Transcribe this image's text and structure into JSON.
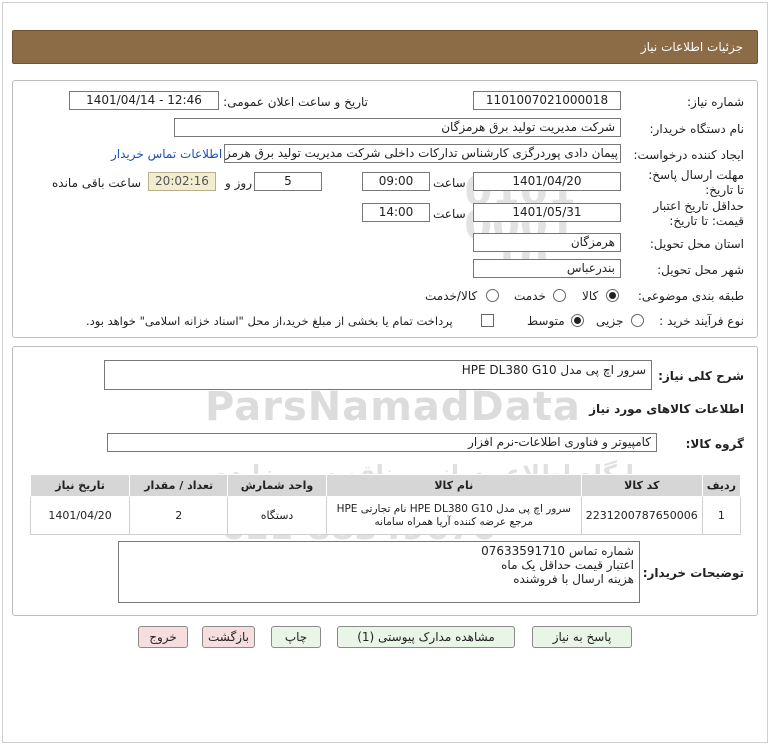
{
  "header": {
    "title": "جزئیات اطلاعات نیاز"
  },
  "form": {
    "need_number_label": "شماره نیاز:",
    "need_number": "1101007021000018",
    "announce_label": "تاریخ و ساعت اعلان عمومی:",
    "announce_value": "1401/04/14 - 12:46",
    "buyer_org_label": "نام دستگاه خریدار:",
    "buyer_org": "شرکت مدیریت تولید برق هرمزگان",
    "creator_label": "ایجاد کننده درخواست:",
    "creator": "پیمان دادی پوردرگزی کارشناس تدارکات داخلی شرکت مدیریت تولید برق هرمزگا",
    "contact_link": "اطلاعات تماس خریدار",
    "reply_deadline_label": "مهلت ارسال پاسخ: تا تاریخ:",
    "reply_date": "1401/04/20",
    "time_label": "ساعت",
    "reply_time": "09:00",
    "days_value": "5",
    "days_label": "روز و",
    "timer_value": "20:02:16",
    "remaining_label": "ساعت باقی مانده",
    "validity_label": "حداقل تاریخ اعتبار قیمت: تا تاریخ:",
    "validity_date": "1401/05/31",
    "validity_time_label": "ساعت",
    "validity_time": "14:00",
    "province_label": "استان محل تحویل:",
    "province": "هرمزگان",
    "city_label": "شهر محل تحویل:",
    "city": "بندرعباس",
    "category_label": "طبقه بندی موضوعی:",
    "category_options": [
      "کالا",
      "خدمت",
      "کالا/خدمت"
    ],
    "category_selected": "کالا",
    "process_label": "نوع فرآیند خرید :",
    "process_options": [
      "جزیی",
      "متوسط"
    ],
    "process_selected": "متوسط",
    "payment_note": "پرداخت تمام یا بخشی از مبلغ خرید،از محل \"اسناد خزانه اسلامی\" خواهد بود."
  },
  "summary": {
    "general_desc_label": "شرح کلی نیاز:",
    "general_desc": "سرور اچ پی مدل HPE DL380 G10",
    "goods_info_title": "اطلاعات کالاهای مورد نیاز",
    "goods_group_label": "گروه کالا:",
    "goods_group": "کامپیوتر و فناوری اطلاعات-نرم افزار"
  },
  "table": {
    "headers": [
      "ردیف",
      "کد کالا",
      "نام کالا",
      "واحد شمارش",
      "تعداد / مقدار",
      "تاریخ نیاز"
    ],
    "rows": [
      {
        "row": "1",
        "code": "2231200787650006",
        "name": "سرور اچ پی مدل HPE DL380 G10 نام تجارتی HPE مرجع عرضه کننده آریا همراه سامانه",
        "unit": "دستگاه",
        "qty": "2",
        "date": "1401/04/20"
      }
    ]
  },
  "buyer_notes": {
    "label": "توضیحات خریدار:",
    "lines": [
      "شماره تماس 07633591710",
      "اعتبار قیمت حداقل یک ماه",
      "هزینه ارسال با فروشنده"
    ]
  },
  "buttons": {
    "reply": "پاسخ به نیاز",
    "attachments": "مشاهده مدارک پیوستی (1)",
    "print": "چاپ",
    "back": "بازگشت",
    "exit": "خروج"
  },
  "watermark": {
    "brand": "ParsNamadData",
    "line1": "پایگاه اطلاع رسانی مناقصه و مزایده",
    "line2": "پارس نماد داده ها",
    "phone": "021-88349670",
    "small": "0101 0001 10"
  }
}
